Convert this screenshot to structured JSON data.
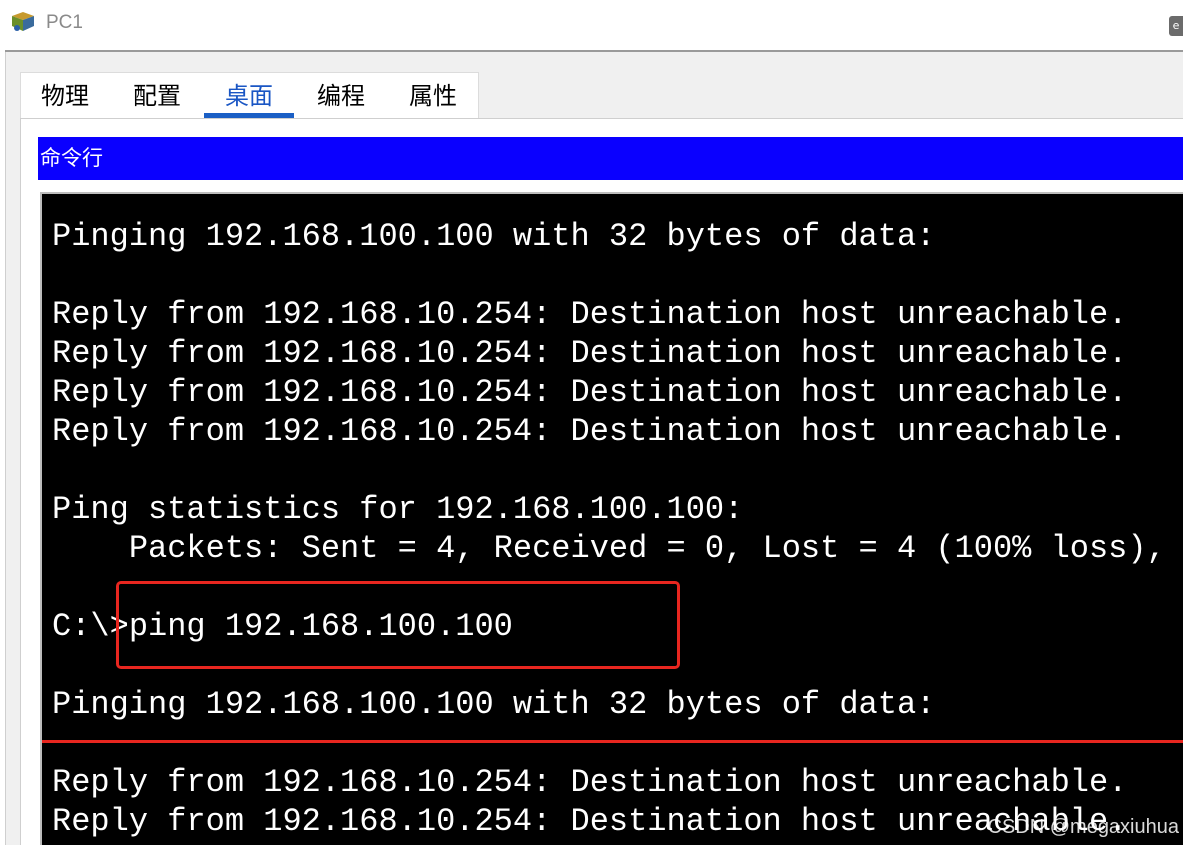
{
  "window": {
    "title": "PC1",
    "app_icon": "packet-tracer-pc-icon",
    "title_button_glyph": "e"
  },
  "tabs": [
    {
      "label": "物理",
      "active": false
    },
    {
      "label": "配置",
      "active": false
    },
    {
      "label": "桌面",
      "active": true
    },
    {
      "label": "编程",
      "active": false
    },
    {
      "label": "属性",
      "active": false
    }
  ],
  "command_prompt": {
    "header_label": "命令行",
    "lines": [
      "Pinging 192.168.100.100 with 32 bytes of data:",
      "",
      "Reply from 192.168.10.254: Destination host unreachable.",
      "Reply from 192.168.10.254: Destination host unreachable.",
      "Reply from 192.168.10.254: Destination host unreachable.",
      "Reply from 192.168.10.254: Destination host unreachable.",
      "",
      "Ping statistics for 192.168.100.100:",
      "    Packets: Sent = 4, Received = 0, Lost = 4 (100% loss),",
      "",
      "C:\\>ping 192.168.100.100",
      "",
      "Pinging 192.168.100.100 with 32 bytes of data:",
      "",
      "Reply from 192.168.10.254: Destination host unreachable.",
      "Reply from 192.168.10.254: Destination host unreachable."
    ]
  },
  "watermark": "CSDN @megaxiuhua",
  "colors": {
    "header_blue": "#0a00ff",
    "active_tab": "#1b5fc5",
    "annotation_red": "#e8261f",
    "terminal_bg": "#000000",
    "terminal_fg": "#ffffff"
  }
}
